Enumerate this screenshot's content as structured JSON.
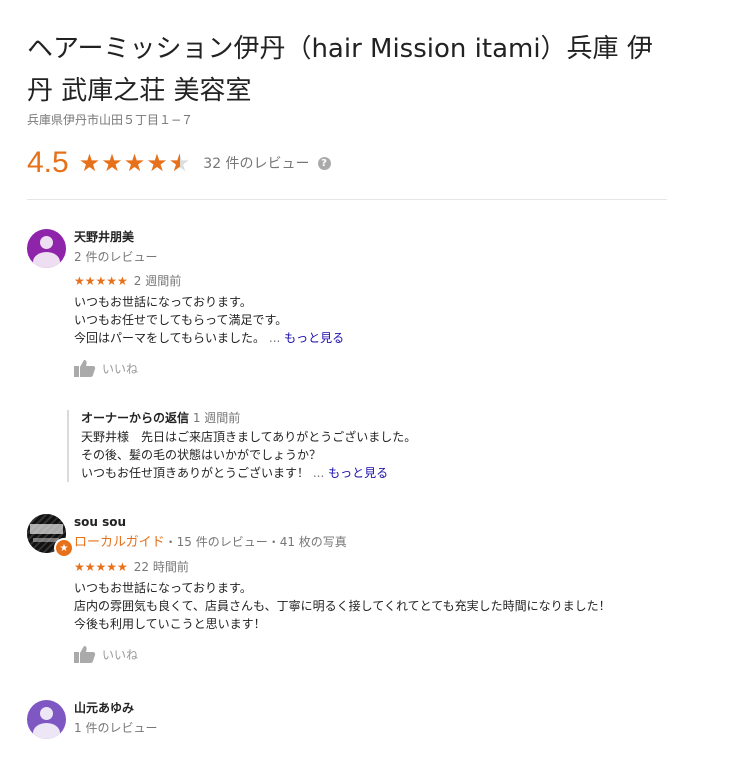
{
  "business": {
    "title": "ヘアーミッション伊丹（hair Mission itami）兵庫 伊丹 武庫之荘 美容室",
    "address": "兵庫県伊丹市山田５丁目１−７",
    "rating": "4.5",
    "rating_value": 4.5,
    "stars": "★★★★☆",
    "review_count": "32 件のレビュー",
    "help_icon": "?"
  },
  "reviews": [
    {
      "name": "天野井朋美",
      "meta": "2 件のレビュー",
      "stars": "★★★★★",
      "rating_value": 5,
      "when": "2 週間前",
      "text": "いつもお世話になっております。\nいつもお任せでしてもらって満足です。\n今回はパーマをしてもらいました。",
      "ellipsis": "...",
      "more": "もっと見る",
      "like": "いいね",
      "owner_reply": {
        "label": "オーナーからの返信",
        "when": "1 週間前",
        "text": "天野井様　先日はご来店頂きましてありがとうございました。\nその後、髪の毛の状態はいかがでしょうか？\nいつもお任せ頂きありがとうございます！",
        "ellipsis": "...",
        "more": "もっと見る"
      }
    },
    {
      "name": "sou sou",
      "guide": "ローカルガイド",
      "meta": "・15 件のレビュー・41 枚の写真",
      "stars": "★★★★★",
      "rating_value": 5,
      "when": "22 時間前",
      "text": "いつもお世話になっております。\n店内の雰囲気も良くて、店員さんも、丁寧に明るく接してくれてとても充実した時間になりました！\n今後も利用していこうと思います！",
      "like": "いいね"
    },
    {
      "name": "山元あゆみ",
      "meta": "1 件のレビュー"
    }
  ],
  "colors": {
    "star": "#e7711b",
    "link": "#1a0dab",
    "avatar1": "#8e24aa",
    "avatar3": "#7e57c2"
  },
  "icons": {
    "like": "thumbs-up-icon",
    "help": "question-circle-icon",
    "local_guide": "local-guide-star-icon"
  }
}
